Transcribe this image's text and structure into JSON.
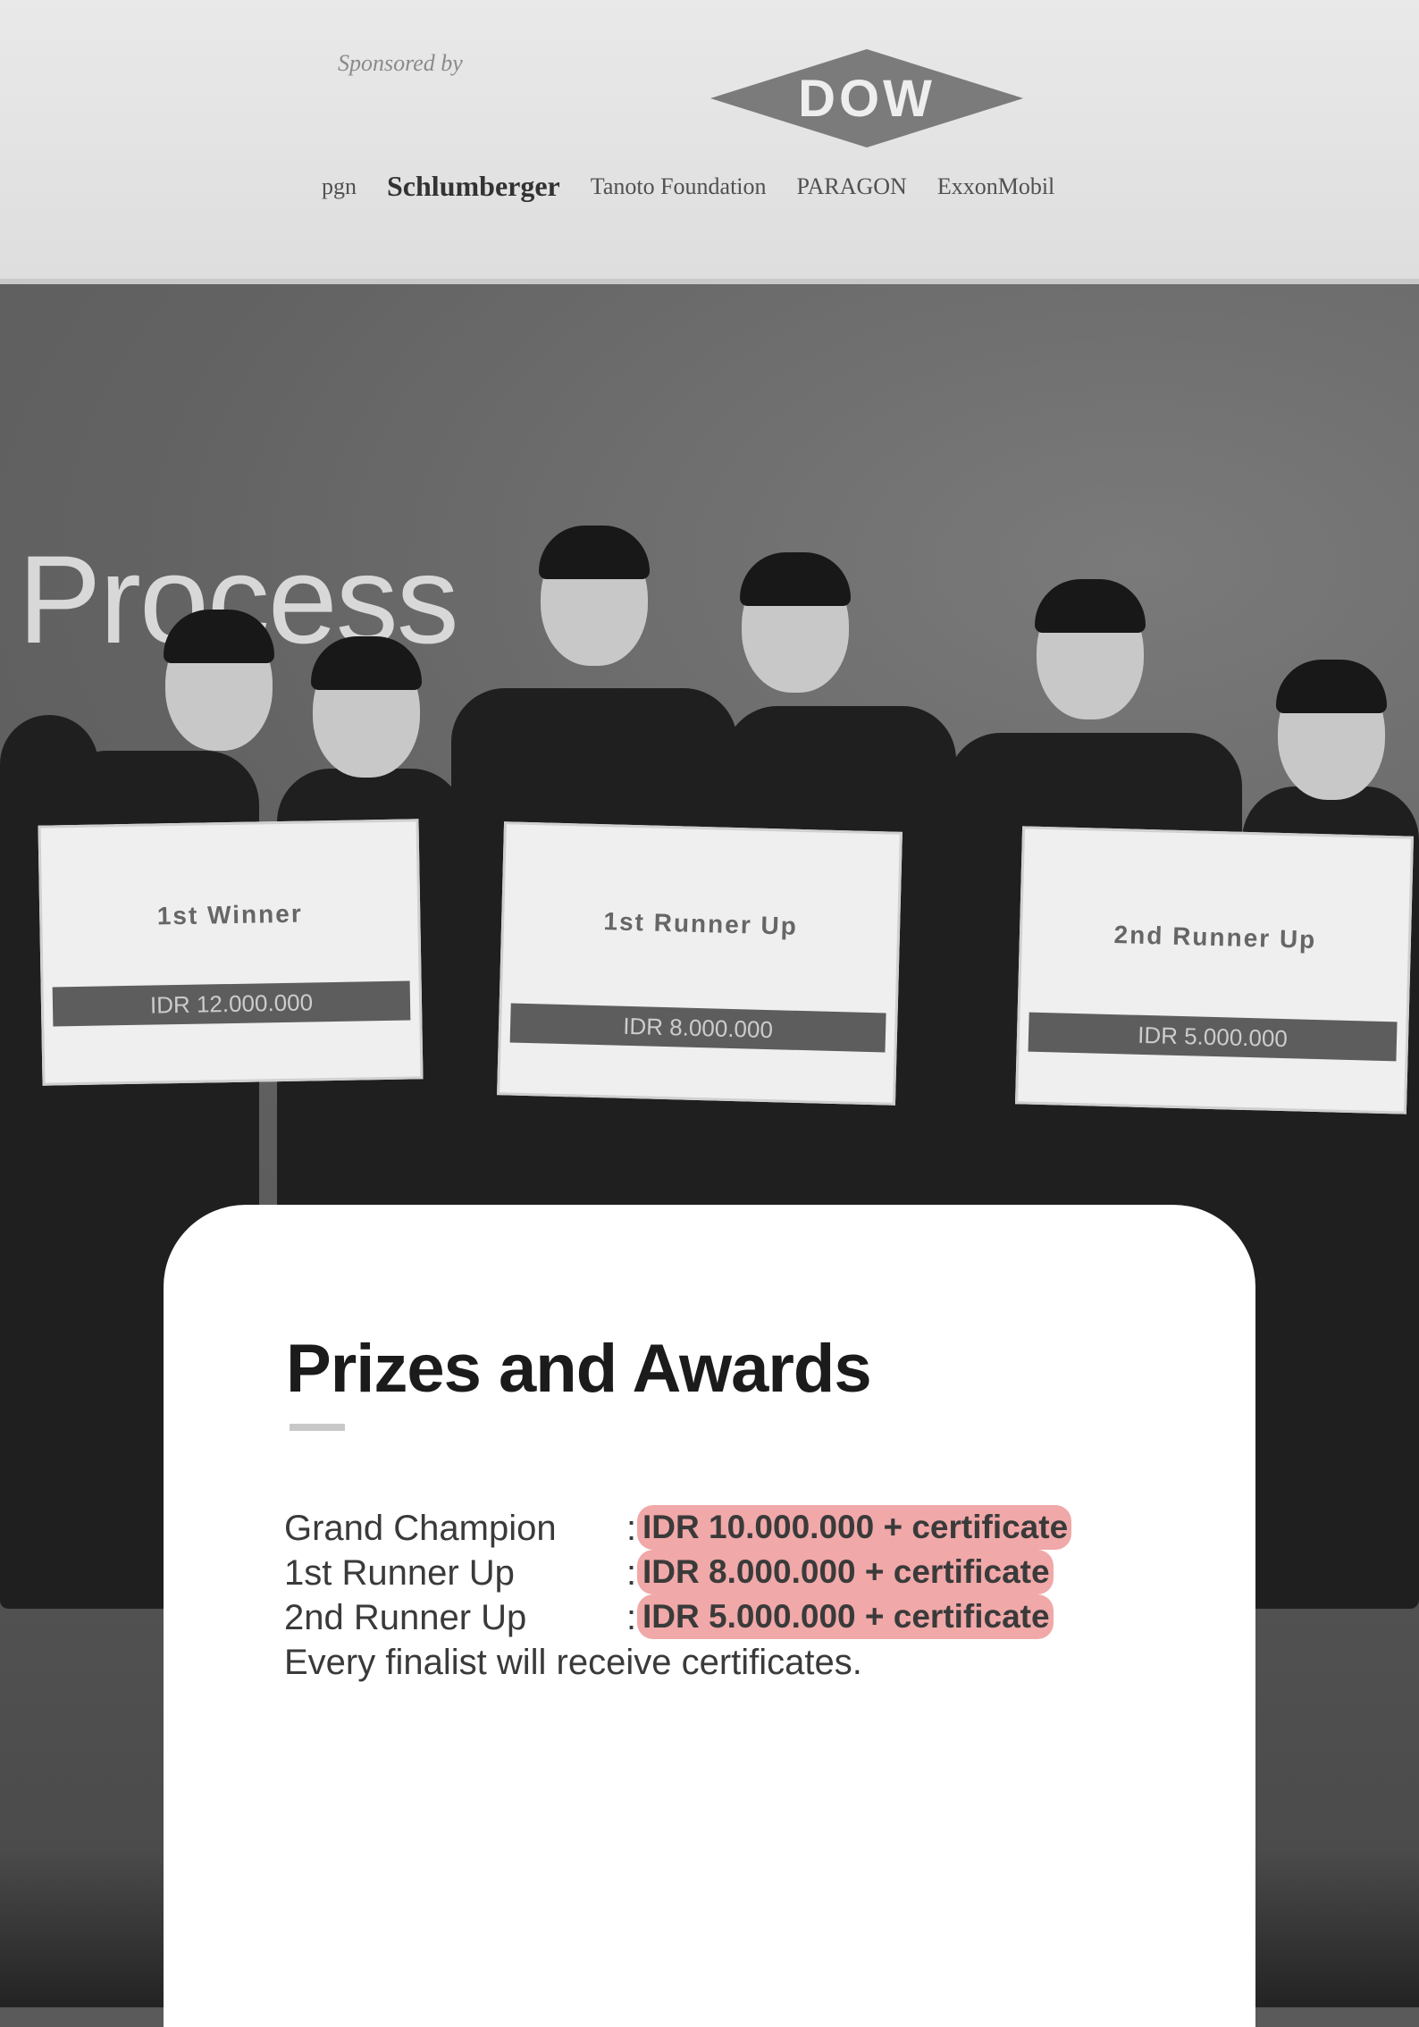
{
  "banner": {
    "sponsored_by": "Sponsored by",
    "main_sponsor": "DOW",
    "sponsor_logos": [
      "pgn",
      "Schlumberger",
      "Tanoto Foundation",
      "PARAGON",
      "ExxonMobil"
    ]
  },
  "backdrop": {
    "text": "Process"
  },
  "boards": [
    {
      "title": "1st Winner",
      "amount": "IDR 12.000.000"
    },
    {
      "title": "1st Runner Up",
      "amount": "IDR 8.000.000"
    },
    {
      "title": "2nd Runner Up",
      "amount": "IDR 5.000.000"
    }
  ],
  "card": {
    "title": "Prizes and Awards",
    "prizes": [
      {
        "label": "Grand Champion",
        "separator": ":",
        "amount": "IDR 10.000.000 + certificate"
      },
      {
        "label": "1st Runner Up",
        "separator": ":",
        "amount": "IDR 8.000.000 + certificate"
      },
      {
        "label": "2nd Runner Up",
        "separator": ":",
        "amount": "IDR 5.000.000 + certificate"
      }
    ],
    "note": "Every finalist will receive certificates."
  },
  "colors": {
    "highlight": "#f0a8a8",
    "card_background": "#ffffff",
    "title_text": "#1b1b1b",
    "body_text": "#3a3a3a"
  }
}
